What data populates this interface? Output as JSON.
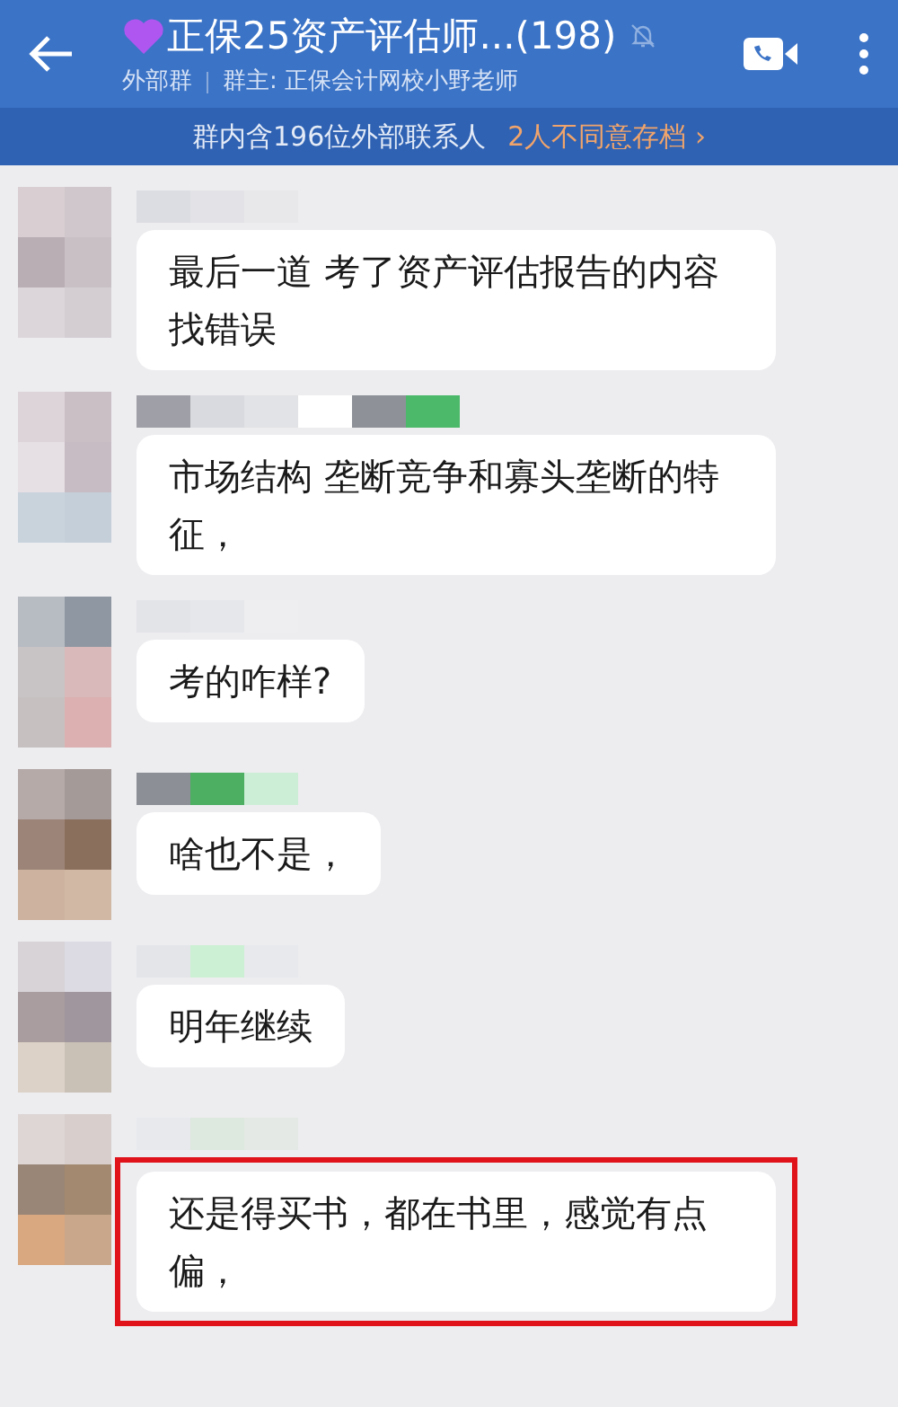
{
  "header": {
    "title": "正保25资产评估师...(198)",
    "subtitle_tag": "外部群",
    "owner": "群主: 正保会计网校小野老师",
    "muted": true
  },
  "banner": {
    "text": "群内含196位外部联系人",
    "link": "2人不同意存档 ›"
  },
  "messages": [
    {
      "text": "最后一道 考了资产评估报告的内容找错误",
      "highlighted": false
    },
    {
      "text": "市场结构  垄断竞争和寡头垄断的特征，",
      "highlighted": false
    },
    {
      "text": "考的咋样?",
      "highlighted": false
    },
    {
      "text": "啥也不是，",
      "highlighted": false
    },
    {
      "text": "明年继续",
      "highlighted": false
    },
    {
      "text": "还是得买书，都在书里，感觉有点偏，",
      "highlighted": true
    }
  ]
}
